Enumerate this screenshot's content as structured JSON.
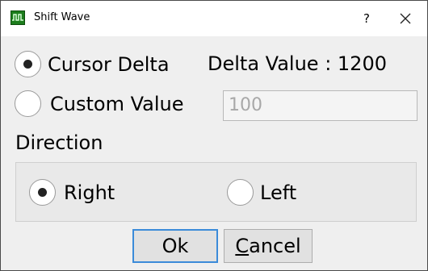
{
  "window": {
    "title": "Shift Wave",
    "help_label": "?",
    "app_icon": "waveform-icon",
    "close_icon": "close-icon"
  },
  "shift_mode": {
    "cursor_delta": {
      "label": "Cursor Delta",
      "info": "Delta Value : 1200",
      "checked": true
    },
    "custom_value": {
      "label": "Custom Value",
      "value": "100",
      "checked": false,
      "enabled": false
    }
  },
  "direction": {
    "heading": "Direction",
    "right": {
      "label": "Right",
      "checked": true
    },
    "left": {
      "label": "Left",
      "checked": false
    }
  },
  "buttons": {
    "ok_label": "Ok",
    "cancel_first": "C",
    "cancel_rest": "ancel"
  },
  "colors": {
    "accent_focus": "#3b8bd9",
    "icon_green": "#1c7d1c"
  }
}
